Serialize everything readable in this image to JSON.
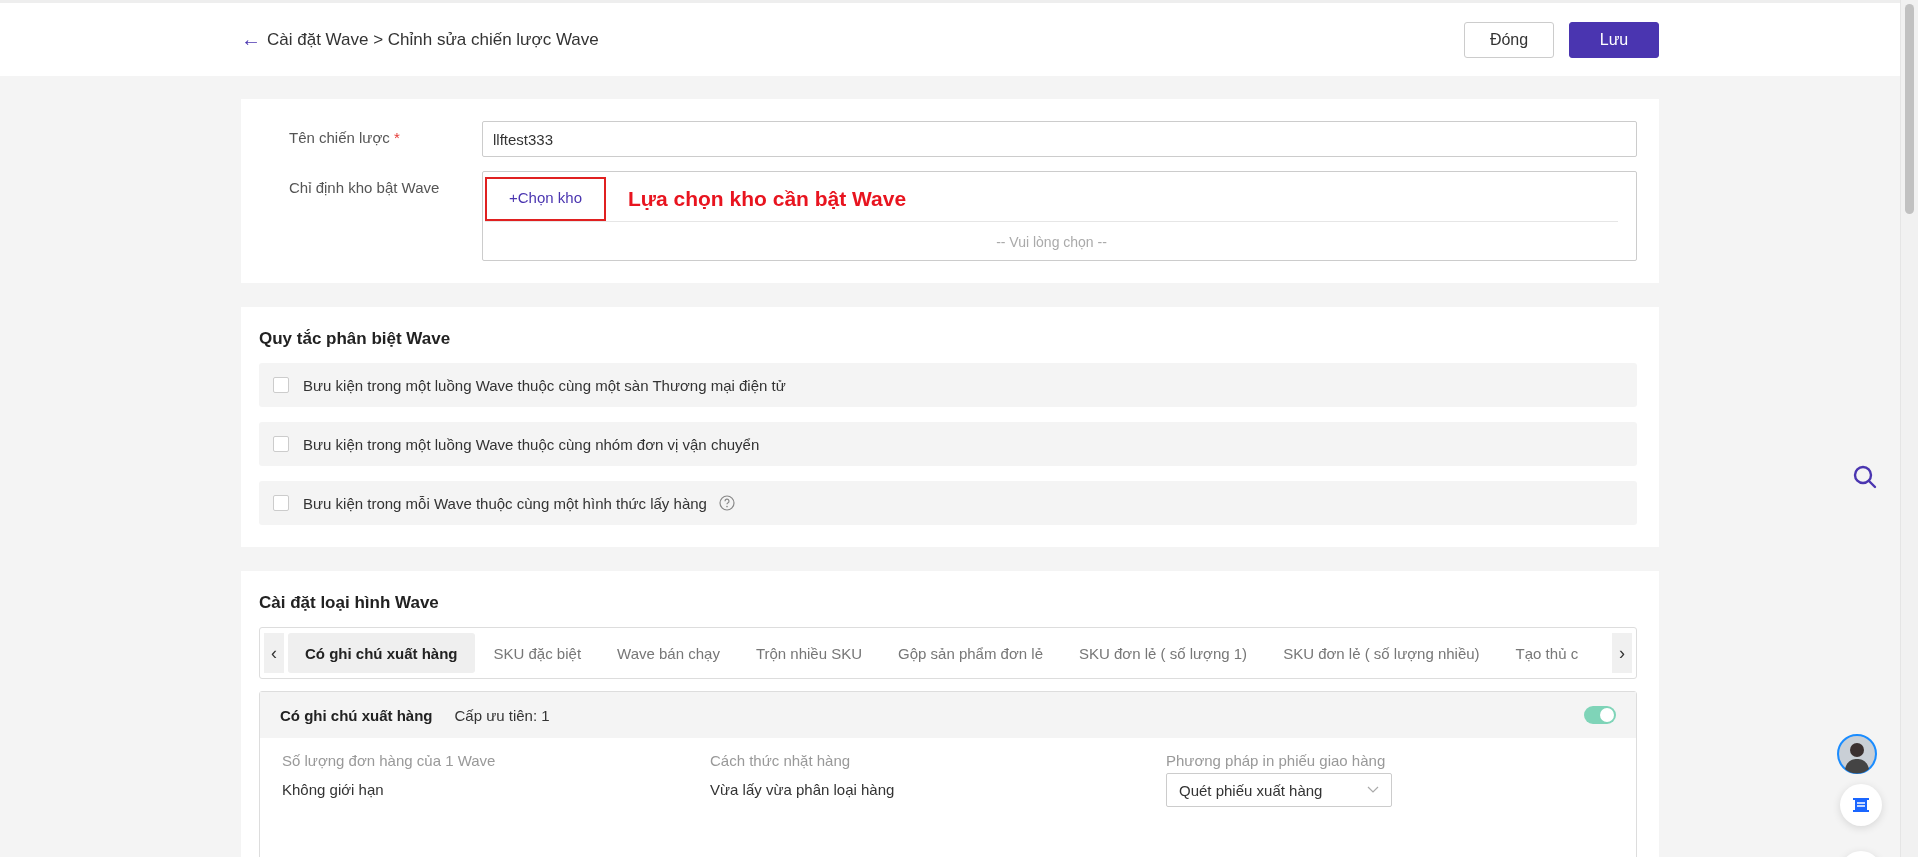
{
  "header": {
    "back": "←",
    "breadcrumb": "Cài đặt Wave > Chỉnh sửa chiến lược Wave",
    "buttons": [
      {
        "label": "Đóng",
        "kind": "secondary"
      },
      {
        "label": "Lưu",
        "kind": "primary"
      }
    ]
  },
  "basic": {
    "name_label": "Tên chiến lược",
    "required_mark": "*",
    "name_value": "llftest333",
    "warehouse_label": "Chỉ định kho bật Wave",
    "choose_link": "+Chọn kho",
    "annotation": "Lựa chọn kho cần bật Wave",
    "empty_hint": "-- Vui lòng chọn --"
  },
  "rules": {
    "title": "Quy tắc phân biệt Wave",
    "items": [
      {
        "label": "Bưu kiện trong một luồng Wave thuộc cùng một sàn Thương mại điện tử",
        "checked": false,
        "help": false
      },
      {
        "label": "Bưu kiện trong một luồng Wave thuộc cùng nhóm đơn vị vận chuyển",
        "checked": false,
        "help": false
      },
      {
        "label": "Bưu kiện trong mỗi Wave thuộc cùng một hình thức lấy hàng",
        "checked": false,
        "help": true
      }
    ]
  },
  "types": {
    "title": "Cài đặt loại hình Wave",
    "prev": "‹",
    "next": "›",
    "tabs": [
      {
        "label": "Có ghi chú xuất hàng",
        "selected": true
      },
      {
        "label": "SKU đặc biệt",
        "selected": false
      },
      {
        "label": "Wave bán chạy",
        "selected": false
      },
      {
        "label": "Trộn nhiều SKU",
        "selected": false
      },
      {
        "label": "Gộp sản phẩm đơn lẻ",
        "selected": false
      },
      {
        "label": "SKU đơn lẻ ( số lượng 1)",
        "selected": false
      },
      {
        "label": "SKU đơn lẻ ( số lượng nhiều)",
        "selected": false
      },
      {
        "label": "Tạo thủ c",
        "selected": false
      }
    ],
    "panel": {
      "title": "Có ghi chú xuất hàng",
      "priority": "Cấp ưu tiên: 1",
      "enabled": true,
      "fields": [
        {
          "label": "Số lượng đơn hàng của 1 Wave",
          "value": "Không giới hạn",
          "kind": "text"
        },
        {
          "label": "Cách thức nhặt hàng",
          "value": "Vừa lấy vừa phân loại hàng",
          "kind": "text"
        },
        {
          "label": "Phương pháp in phiếu giao hàng",
          "value": "Quét phiếu xuất hàng",
          "kind": "select"
        }
      ]
    }
  }
}
